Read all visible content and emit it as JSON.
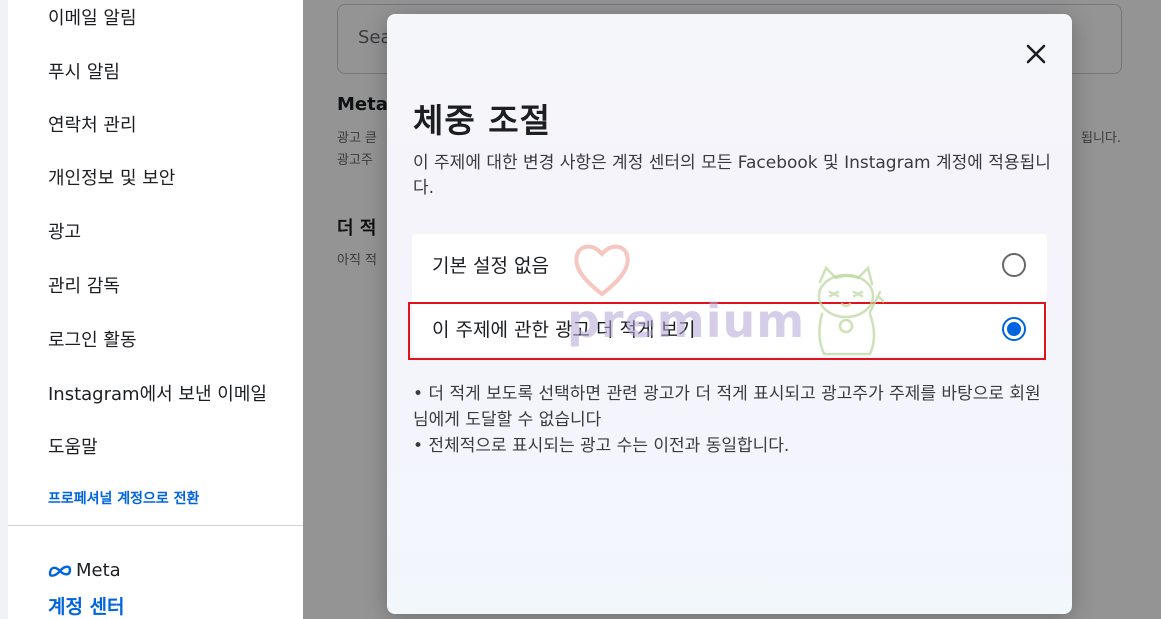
{
  "sidebar": {
    "items": [
      {
        "label": "이메일 알림"
      },
      {
        "label": "푸시 알림"
      },
      {
        "label": "연락처 관리"
      },
      {
        "label": "개인정보 및 보안"
      },
      {
        "label": "광고"
      },
      {
        "label": "관리 감독"
      },
      {
        "label": "로그인 활동"
      },
      {
        "label": "Instagram에서 보낸 이메일"
      },
      {
        "label": "도움말"
      }
    ],
    "switch_link": "프로페셔널 계정으로 전환",
    "brand": "Meta",
    "account_center": "계정 센터"
  },
  "background": {
    "search_placeholder": "Sea",
    "title": "Meta",
    "line1": "광고 큳",
    "line1_right": "됩니다.",
    "line2": "광고주",
    "subtitle": "더 적",
    "sub_text": "아직 적"
  },
  "modal": {
    "title": "체중 조절",
    "description": "이 주제에 대한 변경 사항은 계정 센터의 모든 Facebook 및 Instagram 계정에 적용됩니다.",
    "options": [
      {
        "label": "기본 설정 없음",
        "selected": false
      },
      {
        "label": "이 주제에 관한 광고 더 적게 보기",
        "selected": true
      }
    ],
    "notes": [
      "• 더 적게 보도록 선택하면 관련 광고가 더 적게 표시되고 광고주가 주제를 바탕으로 회원님에게 도달할 수 없습니다",
      "• 전체적으로 표시되는 광고 수는 이전과 동일합니다."
    ]
  },
  "watermark": {
    "text": "premium"
  },
  "colors": {
    "accent": "#0064e0",
    "highlight_border": "#e0121b"
  },
  "icons": [
    "close-icon",
    "meta-logo-icon",
    "heart-icon",
    "cat-icon"
  ]
}
